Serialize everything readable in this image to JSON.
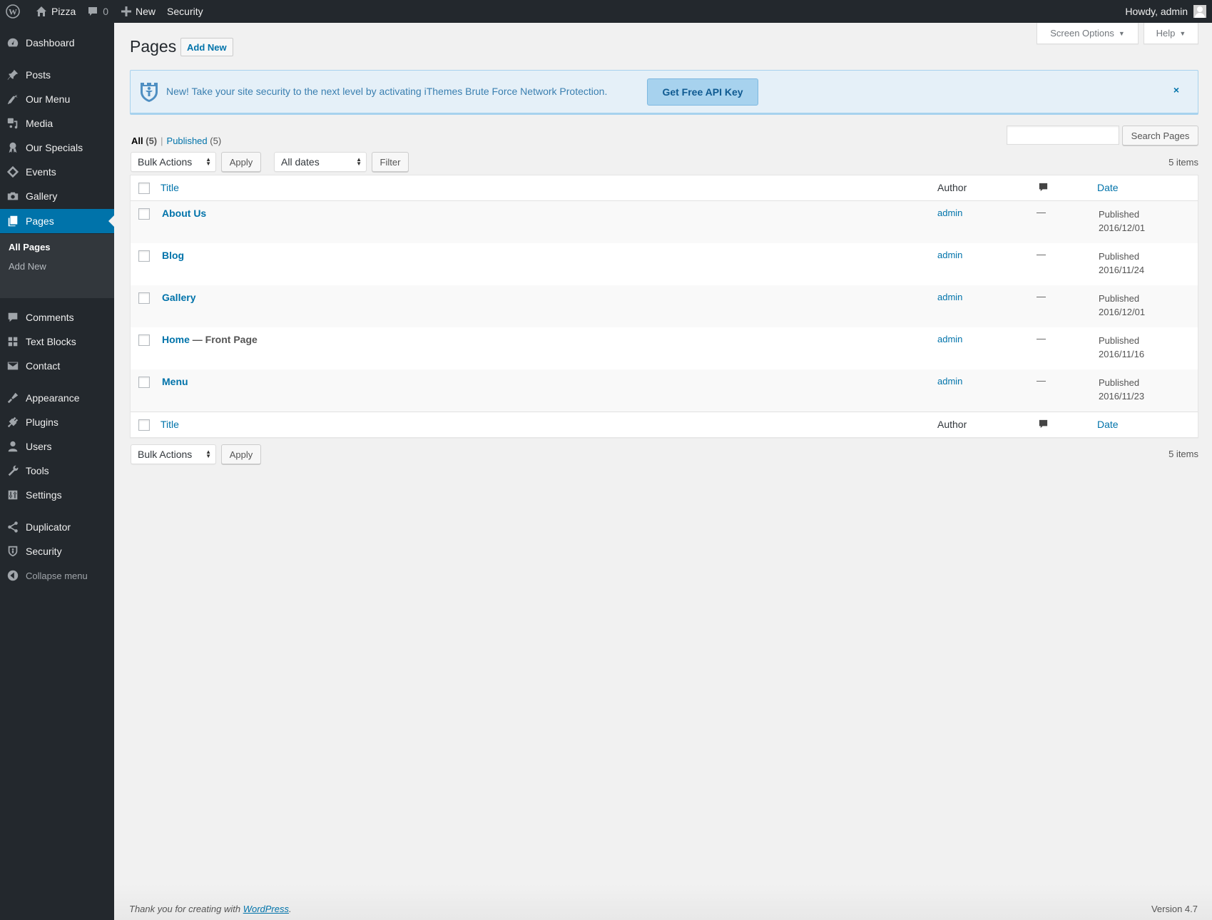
{
  "adminbar": {
    "site_name": "Pizza",
    "comments_count": "0",
    "new_label": "New",
    "security_label": "Security",
    "howdy": "Howdy, admin"
  },
  "sidebar": {
    "items": [
      {
        "label": "Dashboard",
        "icon": "dashboard-icon"
      },
      {
        "label": "Posts",
        "icon": "pin-icon"
      },
      {
        "label": "Our Menu",
        "icon": "carrot-icon"
      },
      {
        "label": "Media",
        "icon": "media-icon"
      },
      {
        "label": "Our Specials",
        "icon": "award-icon"
      },
      {
        "label": "Events",
        "icon": "ticket-icon"
      },
      {
        "label": "Gallery",
        "icon": "camera-icon"
      },
      {
        "label": "Pages",
        "icon": "pages-icon",
        "current": true
      },
      {
        "label": "Comments",
        "icon": "comment-icon"
      },
      {
        "label": "Text Blocks",
        "icon": "grid-icon"
      },
      {
        "label": "Contact",
        "icon": "email-icon"
      },
      {
        "label": "Appearance",
        "icon": "brush-icon"
      },
      {
        "label": "Plugins",
        "icon": "plugin-icon"
      },
      {
        "label": "Users",
        "icon": "user-icon"
      },
      {
        "label": "Tools",
        "icon": "wrench-icon"
      },
      {
        "label": "Settings",
        "icon": "settings-icon"
      },
      {
        "label": "Duplicator",
        "icon": "share-icon"
      },
      {
        "label": "Security",
        "icon": "shield-icon"
      },
      {
        "label": "Collapse menu",
        "icon": "collapse-icon"
      }
    ],
    "submenu": [
      {
        "label": "All Pages",
        "current": true
      },
      {
        "label": "Add New"
      }
    ]
  },
  "header": {
    "screen_options": "Screen Options",
    "help": "Help",
    "title": "Pages",
    "add_new": "Add New"
  },
  "notice": {
    "message": "New! Take your site security to the next level by activating iThemes Brute Force Network Protection.",
    "button": "Get Free API Key",
    "dismiss": "×"
  },
  "filters": {
    "views": [
      {
        "label": "All",
        "count": "(5)",
        "current": true
      },
      {
        "label": "Published",
        "count": "(5)"
      }
    ],
    "separator": "|",
    "search_placeholder": "",
    "search_button": "Search Pages",
    "bulk_actions": "Bulk Actions",
    "apply": "Apply",
    "dates": "All dates",
    "filter": "Filter",
    "items_count": "5 items"
  },
  "table": {
    "columns": {
      "title": "Title",
      "author": "Author",
      "comments": "comments-icon",
      "date": "Date"
    },
    "rows": [
      {
        "title": "About Us",
        "state": "",
        "author": "admin",
        "comments": "—",
        "status": "Published",
        "date": "2016/12/01"
      },
      {
        "title": "Blog",
        "state": "",
        "author": "admin",
        "comments": "—",
        "status": "Published",
        "date": "2016/11/24"
      },
      {
        "title": "Gallery",
        "state": "",
        "author": "admin",
        "comments": "—",
        "status": "Published",
        "date": "2016/12/01"
      },
      {
        "title": "Home",
        "state": " — Front Page",
        "author": "admin",
        "comments": "—",
        "status": "Published",
        "date": "2016/11/16"
      },
      {
        "title": "Menu",
        "state": "",
        "author": "admin",
        "comments": "—",
        "status": "Published",
        "date": "2016/11/23"
      }
    ]
  },
  "footer": {
    "thanks_prefix": "Thank you for creating with ",
    "thanks_link": "WordPress",
    "thanks_suffix": ".",
    "version": "Version 4.7"
  },
  "colors": {
    "accent": "#0073aa",
    "adminbar_bg": "#23282d",
    "notice_bg": "#e5f0f8"
  }
}
